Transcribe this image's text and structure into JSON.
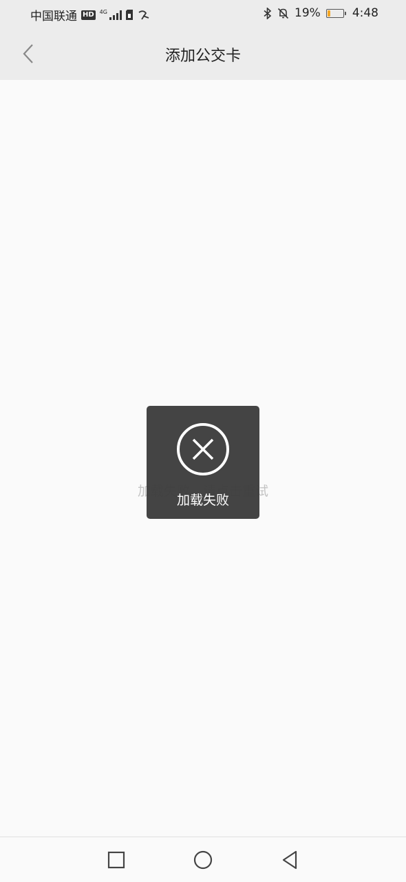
{
  "status_bar": {
    "carrier": "中国联通",
    "hd_badge": "HD",
    "network_type": "4G",
    "battery_percent": "19%",
    "battery_level": 0.19,
    "time": "4:48",
    "icons": [
      "hd-icon",
      "signal-icon",
      "sim-icon",
      "data-icon",
      "bluetooth-icon",
      "mute-bell-icon",
      "battery-icon"
    ],
    "battery_color": "#f5a623"
  },
  "nav": {
    "title": "添加公交卡",
    "back_icon": "chevron-left-icon"
  },
  "content": {
    "background_message": "加载失败，请点击重试"
  },
  "toast": {
    "icon": "close-circle-icon",
    "message": "加载失败"
  },
  "system_nav": {
    "buttons": [
      "recent-apps-icon",
      "home-icon",
      "back-icon"
    ]
  }
}
